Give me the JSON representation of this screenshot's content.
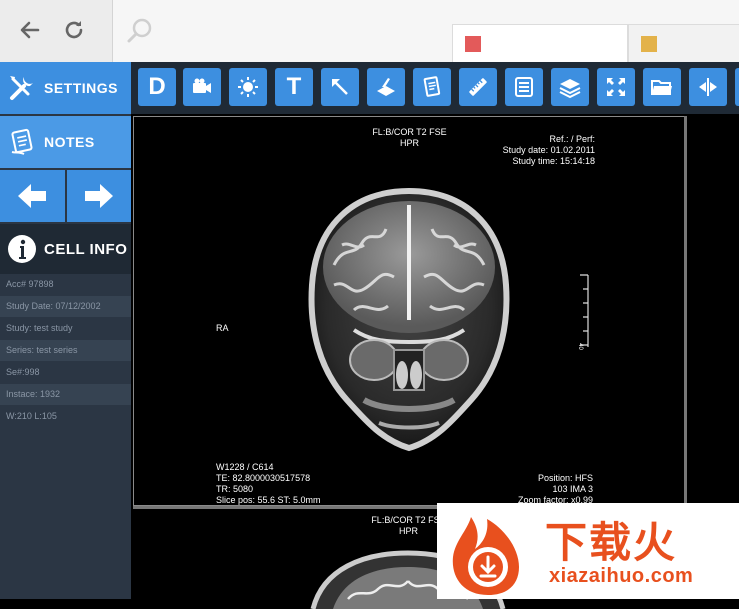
{
  "browser": {
    "tab_colors": [
      "#e35a5a",
      "#e3b24a"
    ]
  },
  "sidebar": {
    "settings_label": "SETTINGS",
    "notes_label": "NOTES",
    "cell_info_label": "CELL INFO",
    "info": [
      "Acc# 97898",
      "Study Date: 07/12/2002",
      "Study: test study",
      "Series: test series",
      "Se#:998",
      "Instace: 1932",
      "W:210 L:105"
    ]
  },
  "toolbar": {
    "d_label": "D",
    "t_label": "T",
    "icons": [
      "video-camera-icon",
      "brightness-icon",
      "text-icon",
      "pointer-arrow-icon",
      "scan-icon",
      "notes-icon",
      "ruler-icon",
      "list-icon",
      "layers-icon",
      "fullscreen-icon",
      "folder-icon",
      "flip-horizontal-icon",
      "flip-vertical-icon"
    ]
  },
  "viewer": {
    "series_title": "FL:B/COR T2 FSE",
    "orientation_top": "HPR",
    "ref_perf": "Ref.: / Perf:",
    "study_date": "Study date: 01.02.2011",
    "study_time": "Study time: 15:14:18",
    "orientation_left": "RA",
    "window_center": "W1228 / C614",
    "te": "TE: 82.8000030517578",
    "tr": "TR: 5080",
    "slice_pos": "Slice pos: 55.6  ST: 5.0mm",
    "position": "Position: HFS",
    "image_number": "103 IMA 3",
    "zoom_factor": "Zoom factor: x0.99",
    "scale_label": "40",
    "bottom_series_title": "FL:B/COR T2 FSE",
    "bottom_orientation": "HPR"
  },
  "watermark": {
    "cn": "下载火",
    "en": "xiazaihuo.com"
  },
  "colors": {
    "accent": "#3d8fe0",
    "sidebar_bg": "#2b3644",
    "toolbar_bg": "#1f2a36"
  }
}
